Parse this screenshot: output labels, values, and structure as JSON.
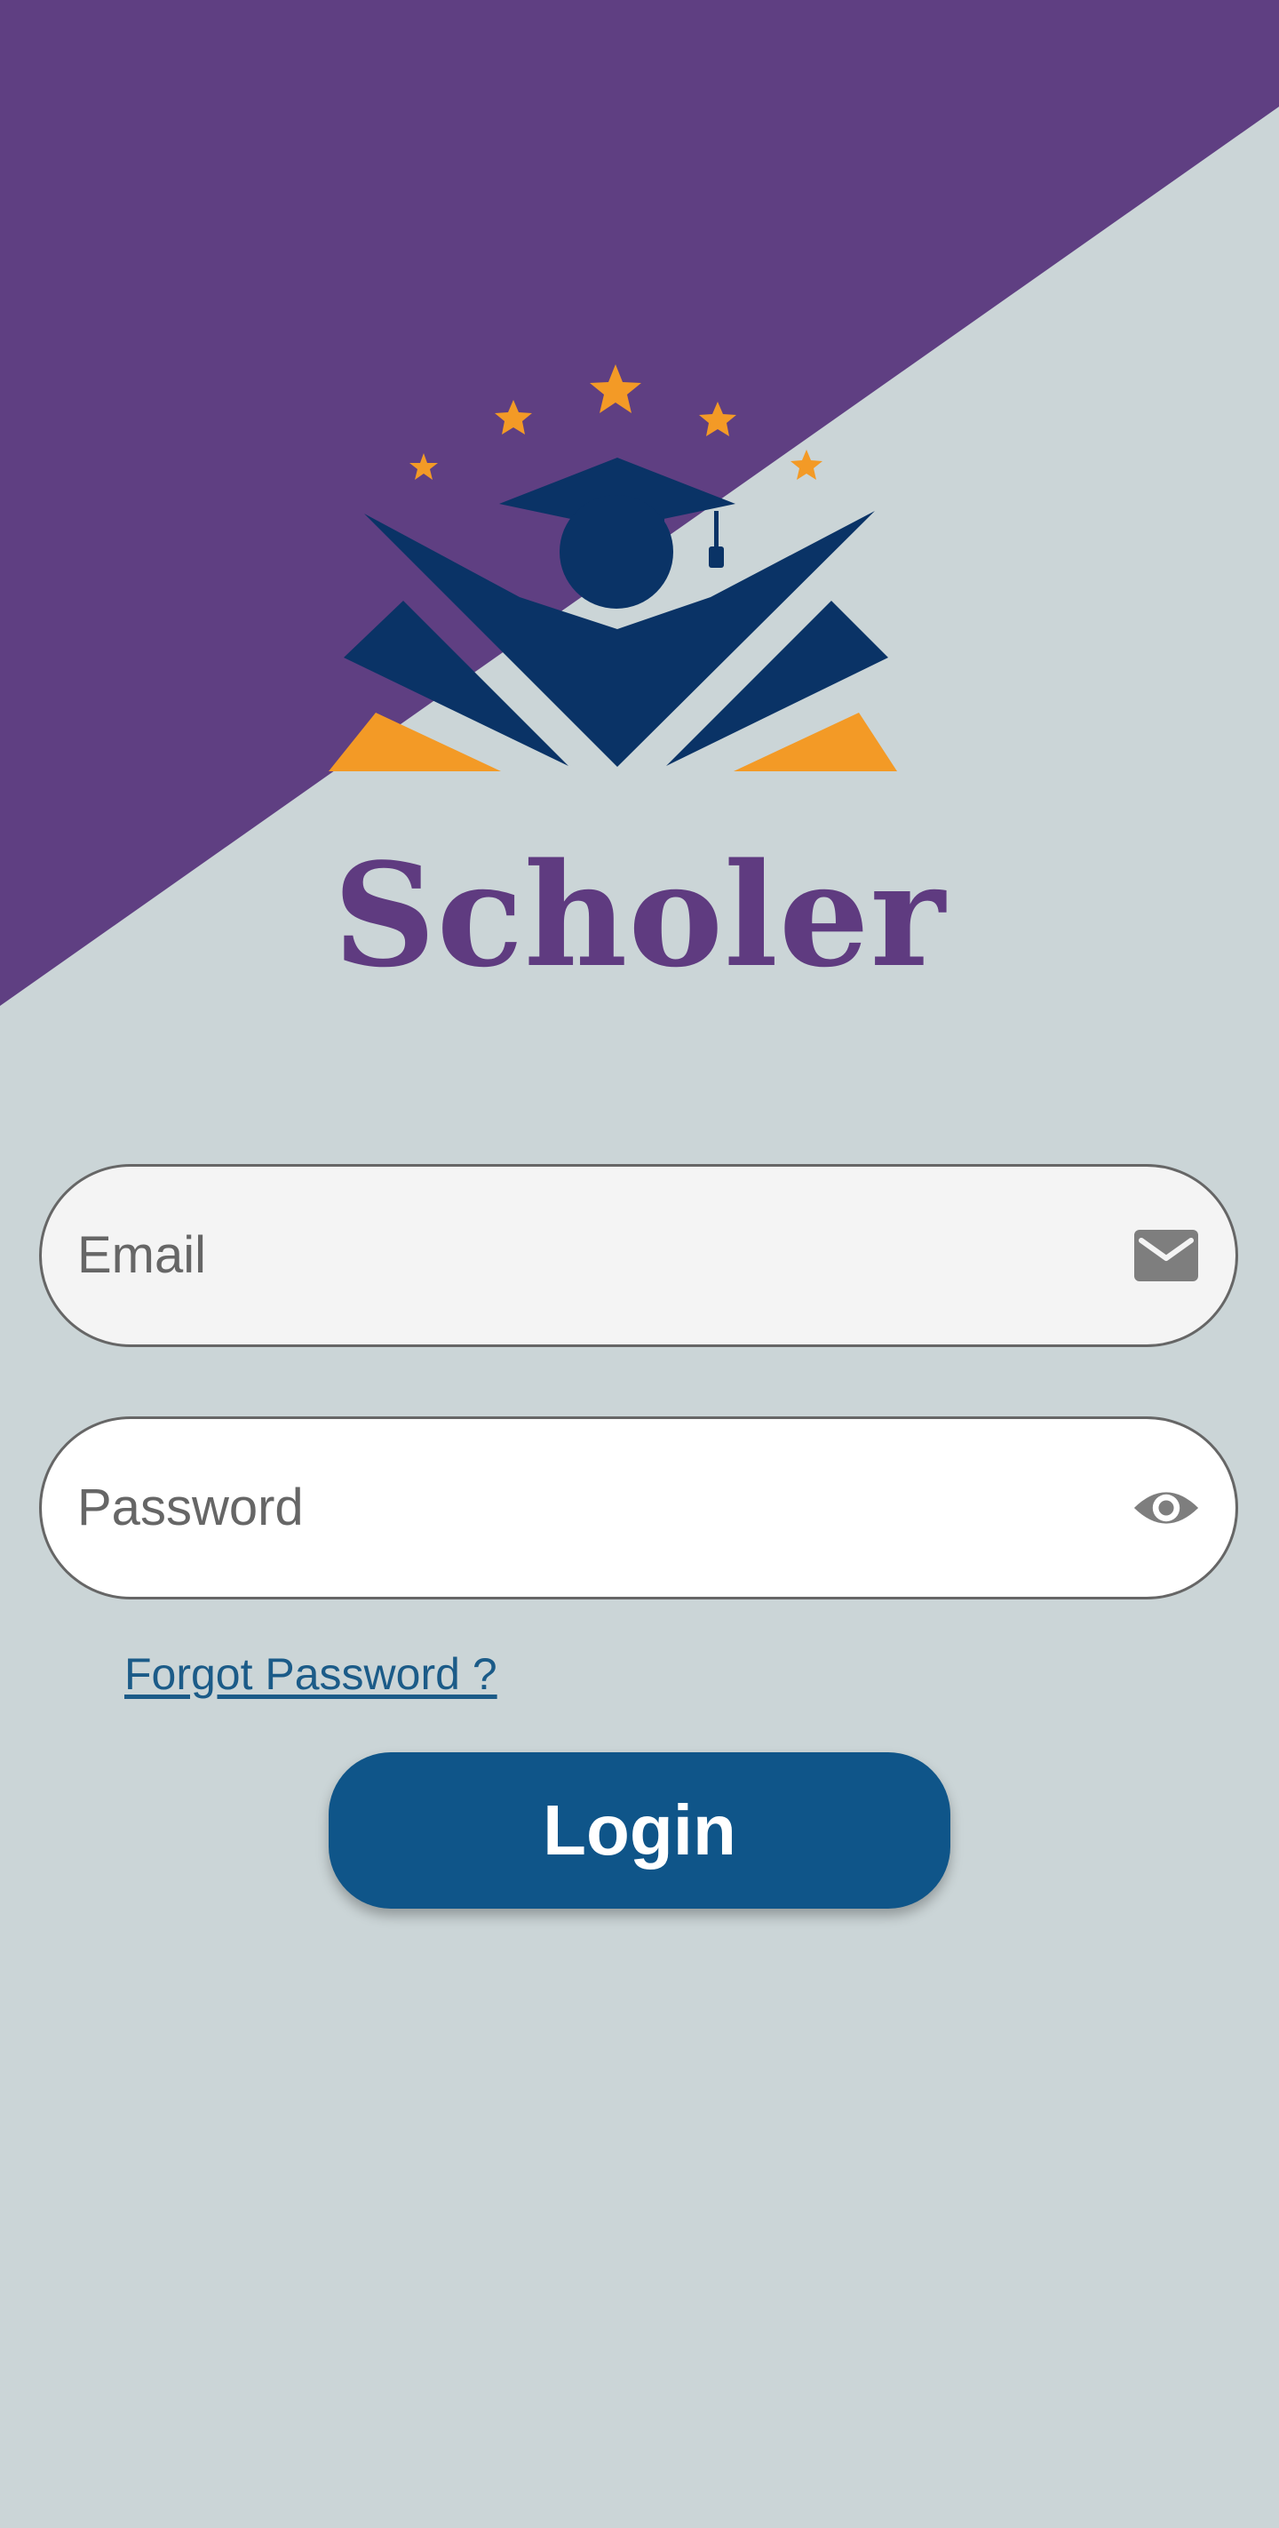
{
  "app": {
    "title": "Scholer"
  },
  "login_form": {
    "email": {
      "placeholder": "Email",
      "value": "",
      "icon": "email-icon"
    },
    "password": {
      "placeholder": "Password",
      "value": "",
      "icon": "eye-icon"
    },
    "forgot_password_label": "Forgot Password ?",
    "login_label": "Login"
  },
  "colors": {
    "background": "#cbd5d7",
    "diagonal_band": "#5f3f82",
    "title": "#5f3b80",
    "logo_navy": "#0a3366",
    "logo_orange": "#f39a26",
    "link": "#1b5b88",
    "button": "#0f5589",
    "button_text": "#ffffff"
  }
}
